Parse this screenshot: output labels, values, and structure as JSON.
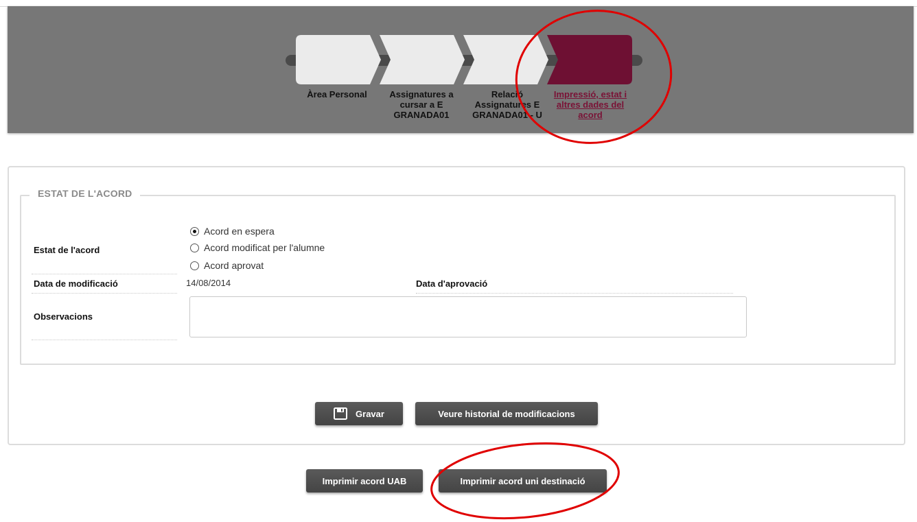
{
  "wizard": {
    "steps": [
      {
        "label": "Àrea Personal",
        "active": false
      },
      {
        "label": "Assignatures a cursar a E GRANADA01",
        "active": false
      },
      {
        "label": "Relació Assignatures E GRANADA01 - U",
        "active": false
      },
      {
        "label": "Impressió, estat i altres dades del acord",
        "active": true
      }
    ],
    "active_color": "#6e1033",
    "inactive_color": "#ebebeb"
  },
  "section": {
    "legend": "ESTAT DE L'ACORD",
    "estat_label": "Estat de l'acord",
    "radio_options": [
      {
        "label": "Acord en espera",
        "checked": true
      },
      {
        "label": "Acord modificat per l'alumne",
        "checked": false
      },
      {
        "label": "Acord aprovat",
        "checked": false
      }
    ],
    "modificacio_label": "Data de modificació",
    "modificacio_value": "14/08/2014",
    "aprovacio_label": "Data d'aprovació",
    "aprovacio_value": "",
    "observacions_label": "Observacions",
    "observacions_value": ""
  },
  "buttons": {
    "save": "Gravar",
    "history": "Veure historial de modificacions",
    "print_uab": "Imprimir acord UAB",
    "print_dest": "Imprimir acord uni destinació"
  },
  "annotation_color": "#e00000"
}
